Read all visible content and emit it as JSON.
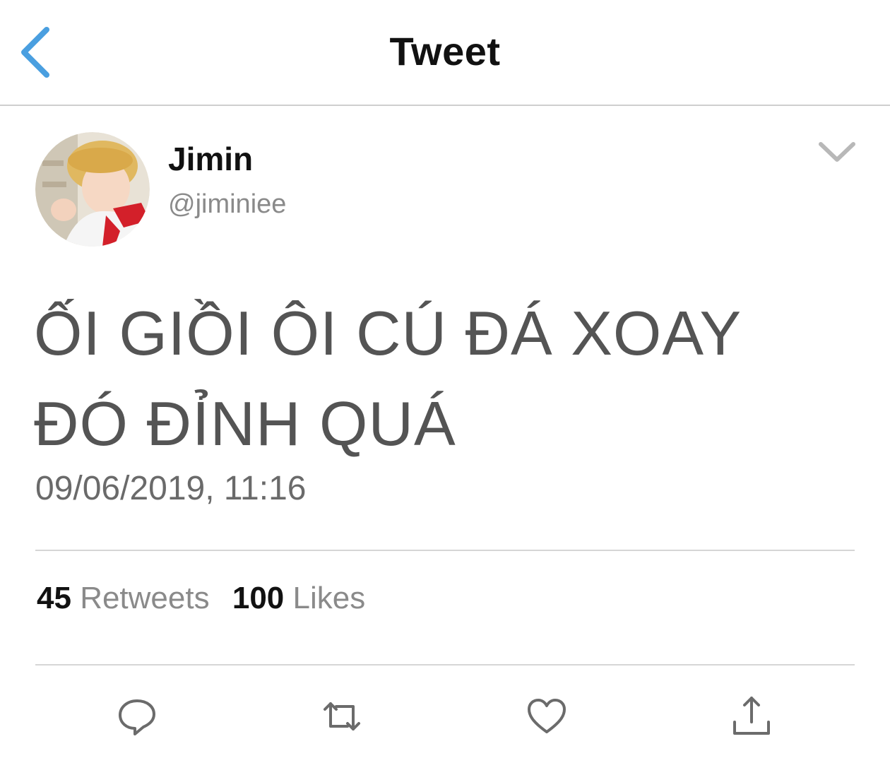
{
  "header": {
    "title": "Tweet",
    "back_icon": "chevron-left-icon",
    "accent_color": "#4a9fe0"
  },
  "author": {
    "display_name": "Jimin",
    "handle": "@jiminiee",
    "avatar_icon": "user-avatar-photo"
  },
  "tweet": {
    "text_line1": "ỐI GIỒI ÔI CÚ ĐÁ XOAY",
    "text_line2": "ĐÓ ĐỈNH QUÁ",
    "timestamp": "09/06/2019, 11:16"
  },
  "stats": {
    "retweets_count": "45",
    "retweets_label": "Retweets",
    "likes_count": "100",
    "likes_label": "Likes"
  },
  "actions": [
    {
      "icon": "reply-icon"
    },
    {
      "icon": "retweet-icon"
    },
    {
      "icon": "like-heart-icon"
    },
    {
      "icon": "share-icon"
    }
  ]
}
